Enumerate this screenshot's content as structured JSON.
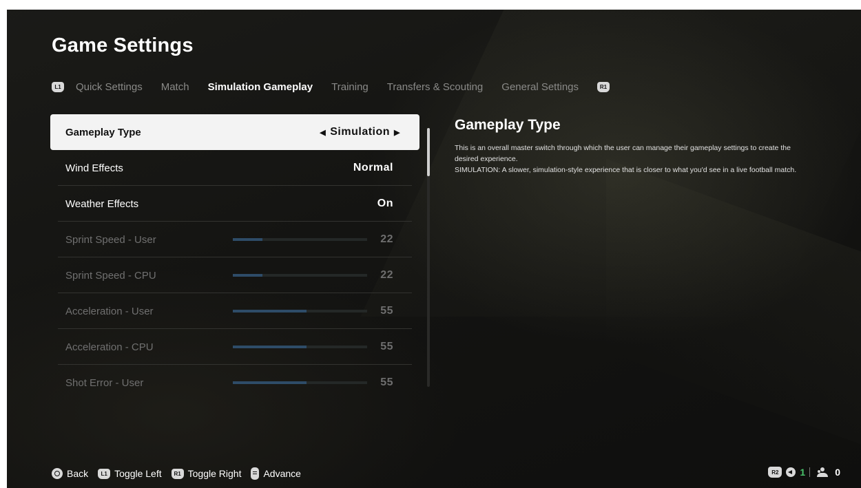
{
  "header": {
    "title": "Game Settings"
  },
  "tabs": {
    "left_badge": "L1",
    "right_badge": "R1",
    "items": [
      {
        "label": "Quick Settings",
        "active": false
      },
      {
        "label": "Match",
        "active": false
      },
      {
        "label": "Simulation Gameplay",
        "active": true
      },
      {
        "label": "Training",
        "active": false
      },
      {
        "label": "Transfers & Scouting",
        "active": false
      },
      {
        "label": "General Settings",
        "active": false
      }
    ]
  },
  "settings": {
    "selected": {
      "label": "Gameplay Type",
      "value": "Simulation",
      "left_arrow": "◀",
      "right_arrow": "▶"
    },
    "rows": [
      {
        "label": "Wind Effects",
        "value": "Normal"
      },
      {
        "label": "Weather Effects",
        "value": "On"
      },
      {
        "label": "Sprint Speed - User",
        "value": "22",
        "slider": 22
      },
      {
        "label": "Sprint Speed - CPU",
        "value": "22",
        "slider": 22
      },
      {
        "label": "Acceleration - User",
        "value": "55",
        "slider": 55
      },
      {
        "label": "Acceleration - CPU",
        "value": "55",
        "slider": 55
      },
      {
        "label": "Shot Error - User",
        "value": "55",
        "slider": 55
      }
    ]
  },
  "description": {
    "title": "Gameplay Type",
    "line1": "This is an overall master switch through which the user can manage their gameplay settings to create the desired experience.",
    "line2": "SIMULATION: A slower, simulation-style experience that is closer to what you'd see in a live football match."
  },
  "footer": {
    "back_label": "Back",
    "toggle_left_label": "Toggle Left",
    "toggle_right_label": "Toggle Right",
    "advance_label": "Advance",
    "l1_badge": "L1",
    "r1_badge": "R1"
  },
  "status": {
    "r2_badge": "R2",
    "voice_count": "1",
    "party_count": "0"
  },
  "colors": {
    "accent_slider": "#2e4c68",
    "selected_row": "#f3f3f3",
    "online_green": "#49c46b"
  }
}
